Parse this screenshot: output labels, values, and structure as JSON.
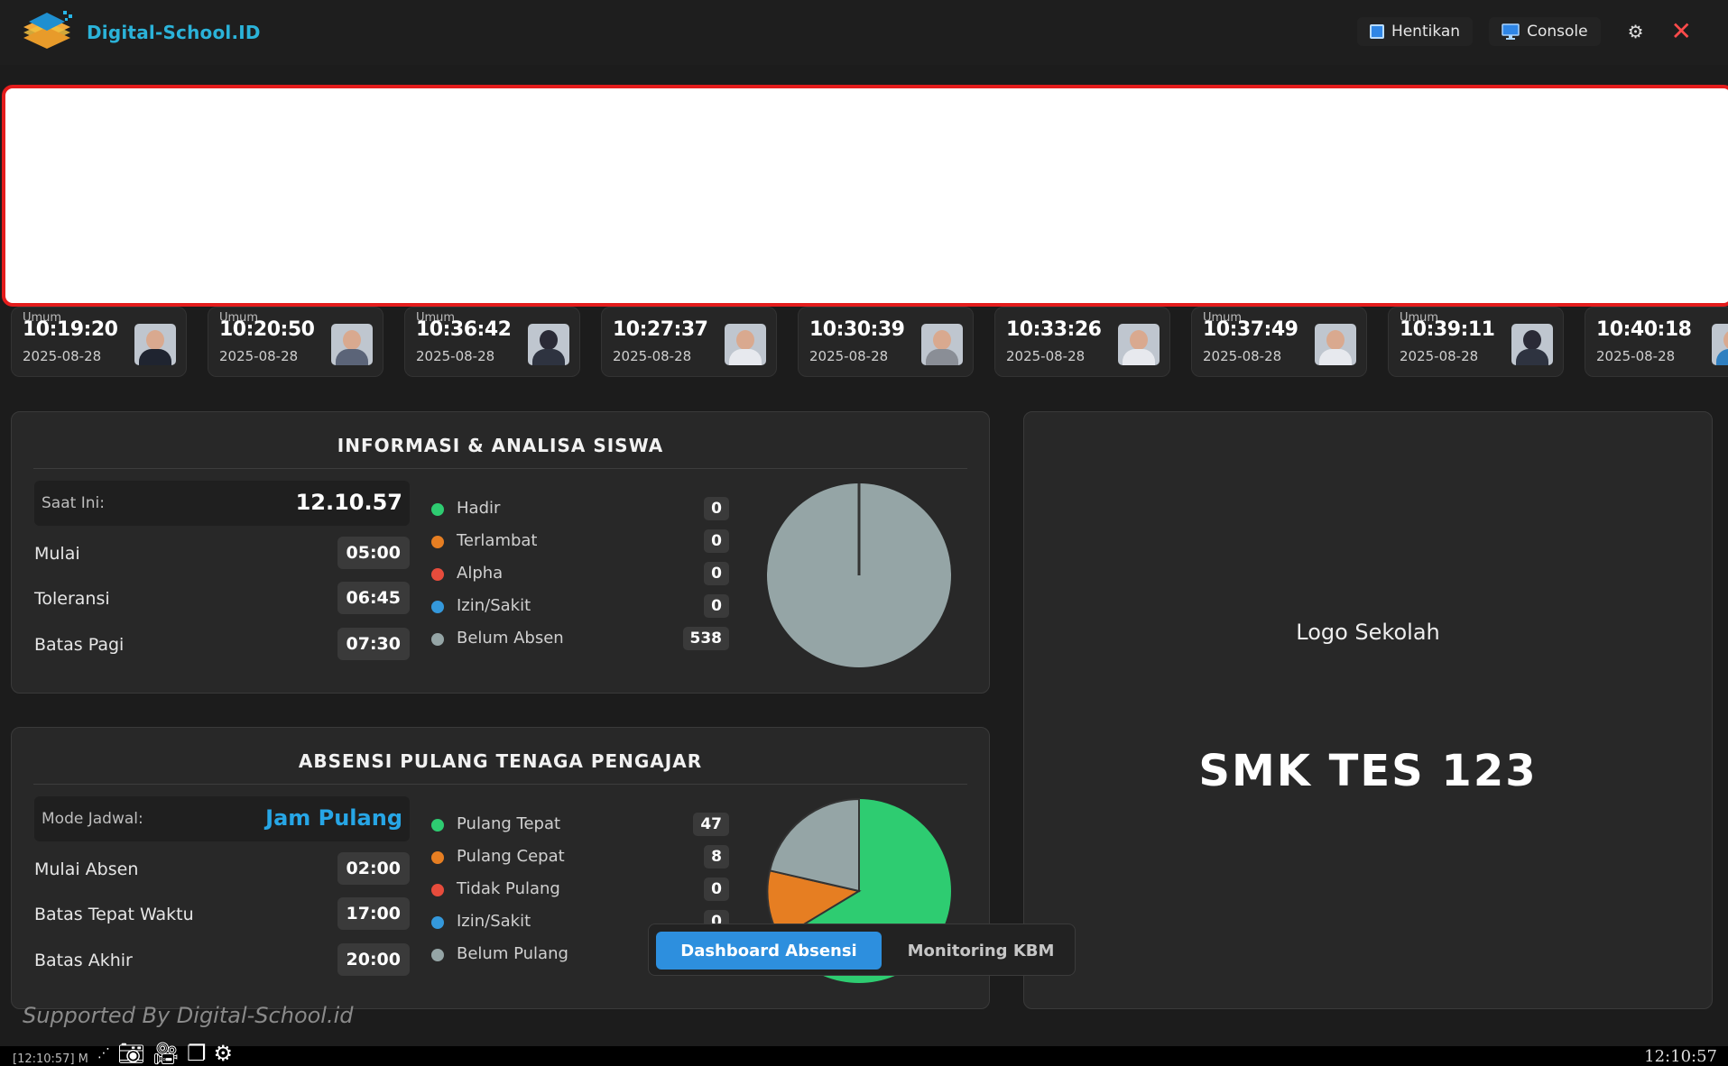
{
  "app": {
    "name": "Digital-School.ID"
  },
  "topbar": {
    "stop_label": "Hentikan",
    "console_label": "Console"
  },
  "cards": [
    {
      "tag": "Umum",
      "time": "10:19:20",
      "date": "2025-08-28",
      "photo": "light"
    },
    {
      "tag": "Umum",
      "time": "10:20:50",
      "date": "2025-08-28",
      "photo": "light"
    },
    {
      "tag": "Umum",
      "time": "10:36:42",
      "date": "2025-08-28",
      "photo": "dark"
    },
    {
      "tag": "",
      "time": "10:27:37",
      "date": "2025-08-28",
      "photo": "light"
    },
    {
      "tag": "",
      "time": "10:30:39",
      "date": "2025-08-28",
      "photo": "light"
    },
    {
      "tag": "",
      "time": "10:33:26",
      "date": "2025-08-28",
      "photo": "light"
    },
    {
      "tag": "Umum",
      "time": "10:37:49",
      "date": "2025-08-28",
      "photo": "light"
    },
    {
      "tag": "Umum",
      "time": "10:39:11",
      "date": "2025-08-28",
      "photo": "dark"
    },
    {
      "tag": "",
      "time": "10:40:18",
      "date": "2025-08-28",
      "photo": "light"
    }
  ],
  "info_panel": {
    "title": "INFORMASI & ANALISA SISWA",
    "now_label": "Saat Ini:",
    "now_value": "12.10.57",
    "rows": [
      {
        "label": "Mulai",
        "value": "05:00"
      },
      {
        "label": "Toleransi",
        "value": "06:45"
      },
      {
        "label": "Batas Pagi",
        "value": "07:30"
      }
    ],
    "legend": [
      {
        "label": "Hadir",
        "count": "0",
        "color": "#2ecc71"
      },
      {
        "label": "Terlambat",
        "count": "0",
        "color": "#e67e22"
      },
      {
        "label": "Alpha",
        "count": "0",
        "color": "#e74c3c"
      },
      {
        "label": "Izin/Sakit",
        "count": "0",
        "color": "#3498db"
      },
      {
        "label": "Belum Absen",
        "count": "538",
        "color": "#95a5a6"
      }
    ]
  },
  "pulang_panel": {
    "title": "ABSENSI PULANG TENAGA PENGAJAR",
    "mode_label": "Mode Jadwal:",
    "mode_value": "Jam Pulang",
    "rows": [
      {
        "label": "Mulai Absen",
        "value": "02:00"
      },
      {
        "label": "Batas Tepat Waktu",
        "value": "17:00"
      },
      {
        "label": "Batas Akhir",
        "value": "20:00"
      }
    ],
    "legend": [
      {
        "label": "Pulang Tepat",
        "count": "47",
        "color": "#2ecc71"
      },
      {
        "label": "Pulang Cepat",
        "count": "8",
        "color": "#e67e22"
      },
      {
        "label": "Tidak Pulang",
        "count": "0",
        "color": "#e74c3c"
      },
      {
        "label": "Izin/Sakit",
        "count": "0",
        "color": "#3498db"
      },
      {
        "label": "Belum Pulang",
        "count": "",
        "color": "#95a5a6"
      }
    ]
  },
  "school": {
    "logo_alt": "Logo Sekolah",
    "name": "SMK TES 123"
  },
  "footer": {
    "supported": "Supported By Digital-School.id"
  },
  "tabs": {
    "dashboard": "Dashboard Absensi",
    "kbm": "Monitoring KBM"
  },
  "statusbar": {
    "log": "[12:10:57] M",
    "clock": "12:10:57"
  },
  "icons": {
    "stop": "stop-square-icon",
    "console": "monitor-icon",
    "settings": "gear-icon",
    "close": "close-icon"
  }
}
